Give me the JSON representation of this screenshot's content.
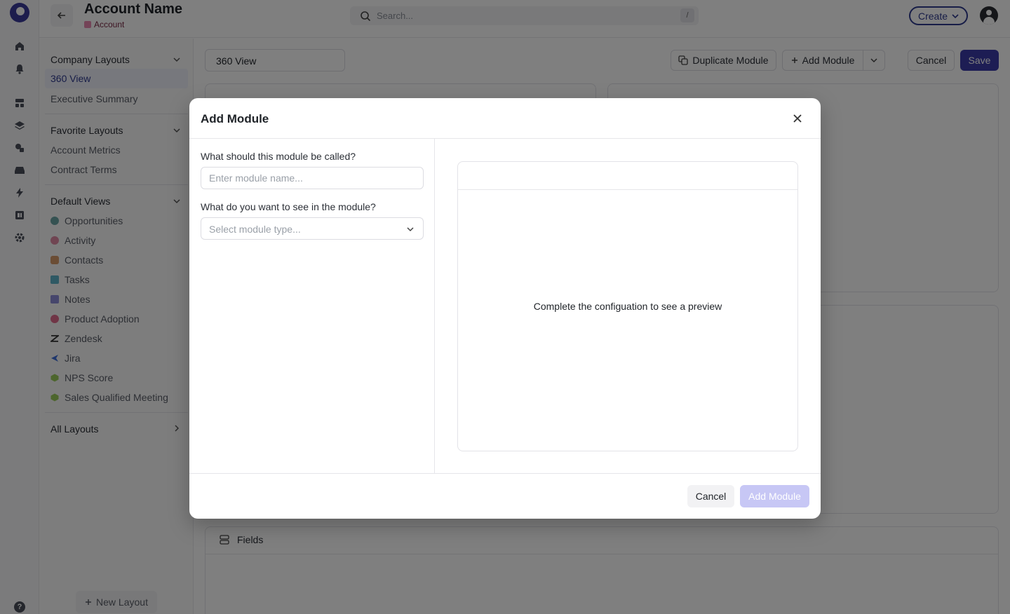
{
  "header": {
    "account_name": "Account Name",
    "account_type": "Account",
    "search_placeholder": "Search...",
    "search_shortcut": "/",
    "create_label": "Create"
  },
  "sidebar": {
    "company_layouts": {
      "title": "Company Layouts",
      "items": [
        "360 View",
        "Executive Summary"
      ],
      "active": "360 View"
    },
    "favorite_layouts": {
      "title": "Favorite Layouts",
      "items": [
        "Account Metrics",
        "Contract Terms"
      ]
    },
    "default_views": {
      "title": "Default Views",
      "items": [
        {
          "label": "Opportunities",
          "icon": "opportunities-icon",
          "color": "#6aa5a5"
        },
        {
          "label": "Activity",
          "icon": "activity-icon",
          "color": "#e08aa5"
        },
        {
          "label": "Contacts",
          "icon": "contacts-icon",
          "color": "#d79a6a"
        },
        {
          "label": "Tasks",
          "icon": "tasks-icon",
          "color": "#5fb3c9"
        },
        {
          "label": "Notes",
          "icon": "notes-icon",
          "color": "#8c8cd9"
        },
        {
          "label": "Product Adoption",
          "icon": "product-adoption-icon",
          "color": "#e06a8c"
        },
        {
          "label": "Zendesk",
          "icon": "zendesk-icon",
          "color": "#333333"
        },
        {
          "label": "Jira",
          "icon": "jira-icon",
          "color": "#3f6fd8"
        },
        {
          "label": "NPS Score",
          "icon": "nps-icon",
          "color": "#9acd5a"
        },
        {
          "label": "Sales Qualified Meeting",
          "icon": "meeting-icon",
          "color": "#9acd5a"
        }
      ]
    },
    "all_layouts": "All Layouts",
    "new_layout": "New Layout"
  },
  "main": {
    "layout_name": "360 View",
    "duplicate_module": "Duplicate Module",
    "add_module": "Add Module",
    "cancel": "Cancel",
    "save": "Save",
    "card_title": "Fields"
  },
  "modal": {
    "title": "Add Module",
    "name_label": "What should this module be called?",
    "name_placeholder": "Enter module name...",
    "type_label": "What do you want to see in the module?",
    "type_placeholder": "Select module type...",
    "preview_message": "Complete the configuation to see a preview",
    "cancel": "Cancel",
    "add": "Add Module"
  }
}
